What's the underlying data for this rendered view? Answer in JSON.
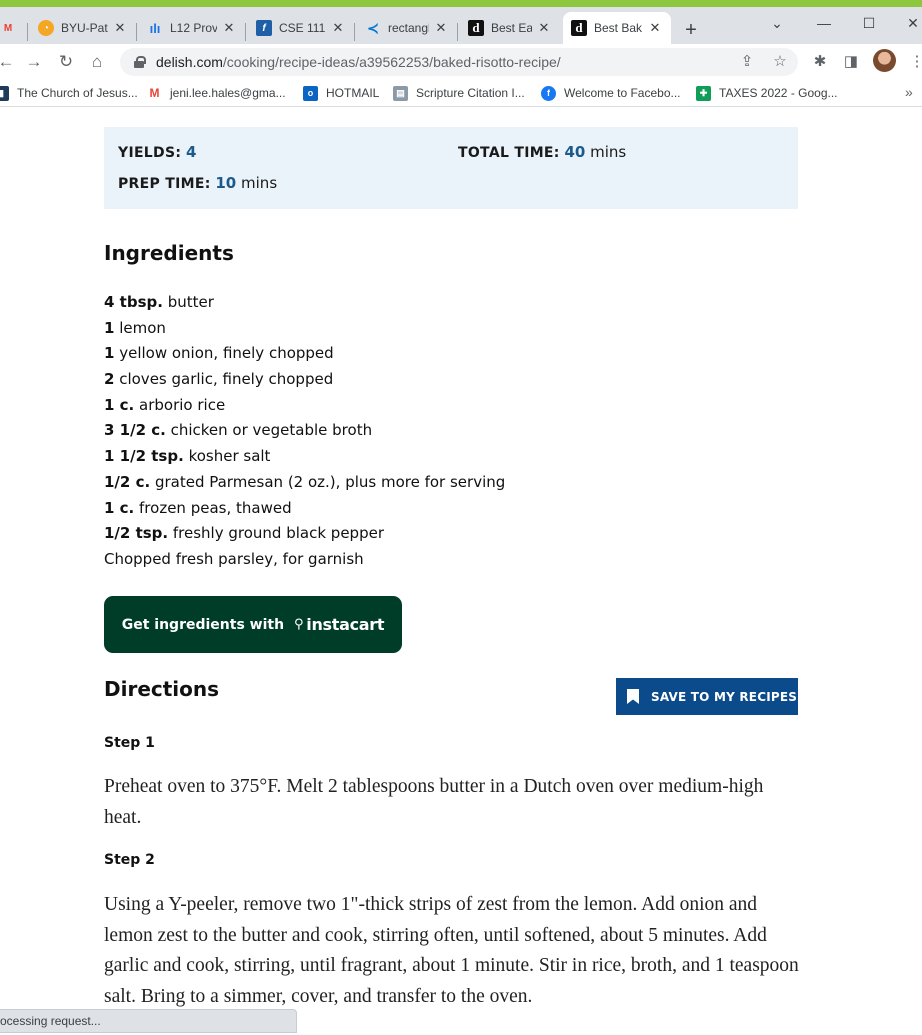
{
  "browser": {
    "tabs": [
      {
        "title": "BYU-Pat",
        "favicon": "byu-icon",
        "active": false
      },
      {
        "title": "L12 Prov",
        "favicon": "chart-icon",
        "active": false
      },
      {
        "title": "CSE 111",
        "favicon": "f-icon",
        "active": false
      },
      {
        "title": "rectangl",
        "favicon": "vscode-icon",
        "active": false
      },
      {
        "title": "Best Eas",
        "favicon": "delish-icon",
        "active": false
      },
      {
        "title": "Best Bak",
        "favicon": "delish-icon",
        "active": true
      }
    ],
    "new_tab": "+",
    "url_host": "delish.com",
    "url_path": "/cooking/recipe-ideas/a39562253/baked-risotto-recipe/",
    "bookmarks": [
      {
        "label": "The Church of Jesus...",
        "icon": "church-icon"
      },
      {
        "label": "jeni.lee.hales@gma...",
        "icon": "gmail-icon"
      },
      {
        "label": "HOTMAIL",
        "icon": "outlook-icon"
      },
      {
        "label": "Scripture Citation I...",
        "icon": "book-icon"
      },
      {
        "label": "Welcome to Facebo...",
        "icon": "facebook-icon"
      },
      {
        "label": "TAXES 2022 - Goog...",
        "icon": "sheets-icon"
      }
    ],
    "status": "ocessing request..."
  },
  "recipe": {
    "yields_label": "YIELDS:",
    "yields_value": "4",
    "total_time_label": "TOTAL TIME:",
    "total_time_value": "40",
    "total_time_unit": "mins",
    "prep_time_label": "PREP TIME:",
    "prep_time_value": "10",
    "prep_time_unit": "mins",
    "ingredients_heading": "Ingredients",
    "ingredients": [
      {
        "qty": "4 tbsp.",
        "item": "butter"
      },
      {
        "qty": "1",
        "item": "lemon"
      },
      {
        "qty": "1",
        "item": "yellow onion, finely chopped"
      },
      {
        "qty": "2",
        "item": "cloves garlic, finely chopped"
      },
      {
        "qty": "1 c.",
        "item": "arborio rice"
      },
      {
        "qty": "3 1/2 c.",
        "item": "chicken or vegetable broth"
      },
      {
        "qty": "1 1/2 tsp.",
        "item": "kosher salt"
      },
      {
        "qty": "1/2 c.",
        "item": "grated Parmesan (2 oz.), plus more for serving"
      },
      {
        "qty": "1 c.",
        "item": "frozen peas, thawed"
      },
      {
        "qty": "1/2 tsp.",
        "item": "freshly ground black pepper"
      },
      {
        "qty": "",
        "item": "Chopped fresh parsley, for garnish"
      }
    ],
    "instacart_label": "Get ingredients with",
    "instacart_brand": "instacart",
    "directions_heading": "Directions",
    "save_label": "SAVE TO MY RECIPES",
    "steps": [
      {
        "label": "Step 1",
        "text": "Preheat oven to 375°F. Melt 2 tablespoons butter in a Dutch oven over medium-high heat."
      },
      {
        "label": "Step 2",
        "text": "Using a Y-peeler, remove two 1\"-thick strips of zest from the lemon. Add onion and lemon zest to the butter and cook, stirring often, until softened, about 5 minutes. Add garlic and cook, stirring, until fragrant, about 1 minute. Stir in rice, broth, and 1 teaspoon salt. Bring to a simmer, cover, and transfer to the oven."
      }
    ]
  },
  "colors": {
    "info_box_bg": "#eaf3fa",
    "info_number": "#1c5a8c",
    "instacart_bg": "#003d29",
    "save_button_bg": "#0b4a8b",
    "browser_accent": "#8dc63f"
  }
}
